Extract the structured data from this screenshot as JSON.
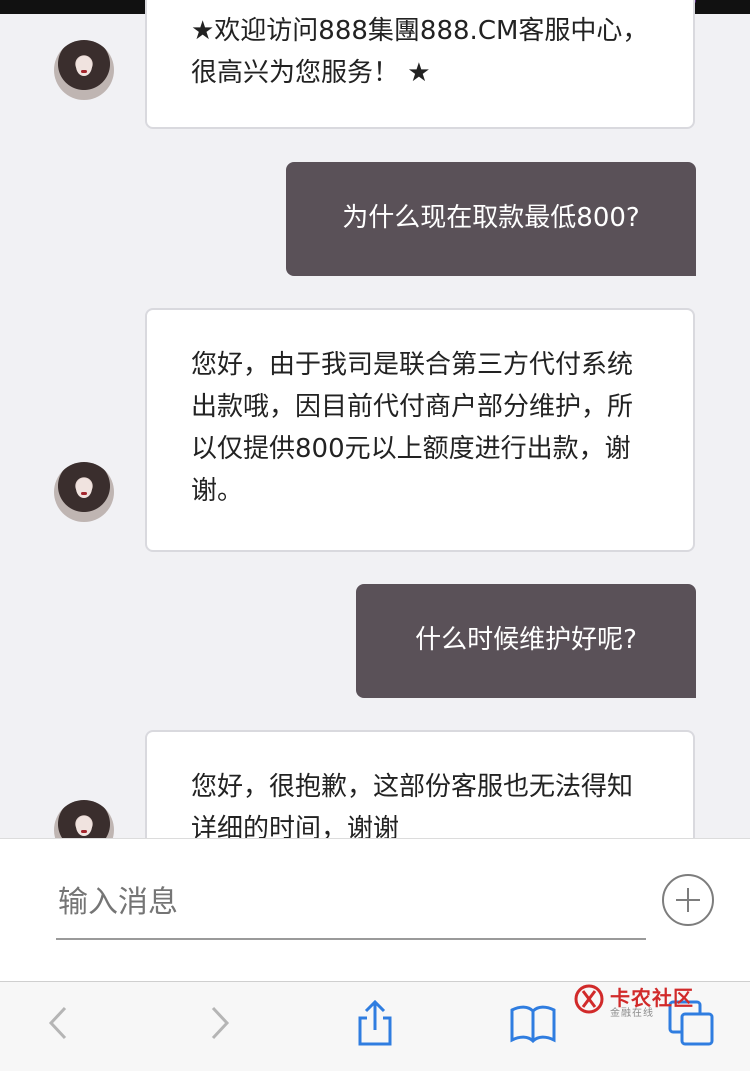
{
  "chat": {
    "messages": [
      {
        "side": "in",
        "text": "★欢迎访问888集團888.CM客服中心，很高兴为您服务！ ★"
      },
      {
        "side": "out",
        "text": "为什么现在取款最低800?"
      },
      {
        "side": "in",
        "text": "您好，由于我司是联合第三方代付系统出款哦，因目前代付商户部分维护，所以仅提供800元以上额度进行出款，谢谢。"
      },
      {
        "side": "out",
        "text": "什么时候维护好呢?"
      },
      {
        "side": "in",
        "text": "您好，很抱歉，这部份客服也无法得知详细的时间，谢谢"
      }
    ]
  },
  "composer": {
    "placeholder": "输入消息"
  },
  "toolbar": {
    "icons": [
      "back-icon",
      "forward-icon",
      "share-icon",
      "bookmarks-icon",
      "tabs-icon"
    ]
  },
  "watermark": {
    "title": "卡农社区",
    "subtitle": "金融在线"
  },
  "colors": {
    "chat_background": "#f1f1f4",
    "outgoing_bubble": "#5a5158",
    "incoming_bubble": "#ffffff",
    "toolbar_icon": "#2f7de0",
    "watermark_red": "#d12a2a"
  }
}
